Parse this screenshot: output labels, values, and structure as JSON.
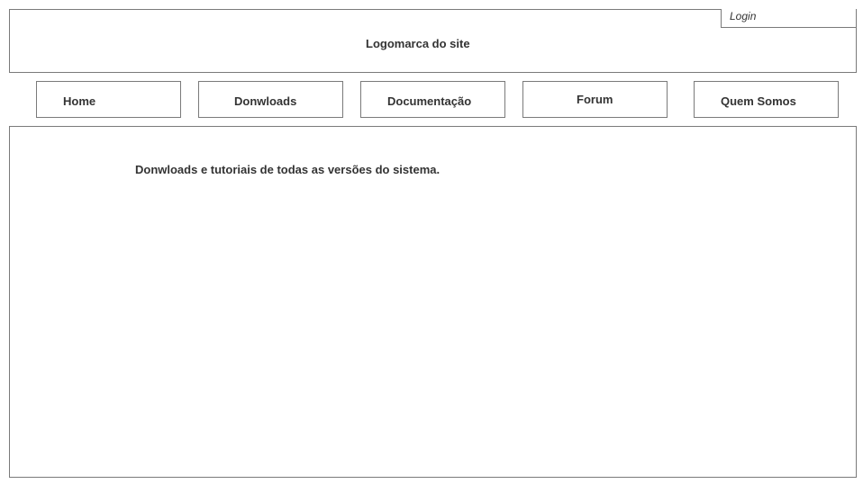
{
  "header": {
    "logo_text": "Logomarca do site",
    "login_label": "Login"
  },
  "nav": {
    "items": [
      {
        "label": "Home"
      },
      {
        "label": "Donwloads"
      },
      {
        "label": "Documentação"
      },
      {
        "label": "Forum"
      },
      {
        "label": "Quem Somos"
      }
    ]
  },
  "main": {
    "text": "Donwloads e tutoriais de todas as versões do sistema."
  },
  "colors": {
    "border": "#7a7a7a",
    "text": "#333333",
    "background": "#ffffff"
  }
}
